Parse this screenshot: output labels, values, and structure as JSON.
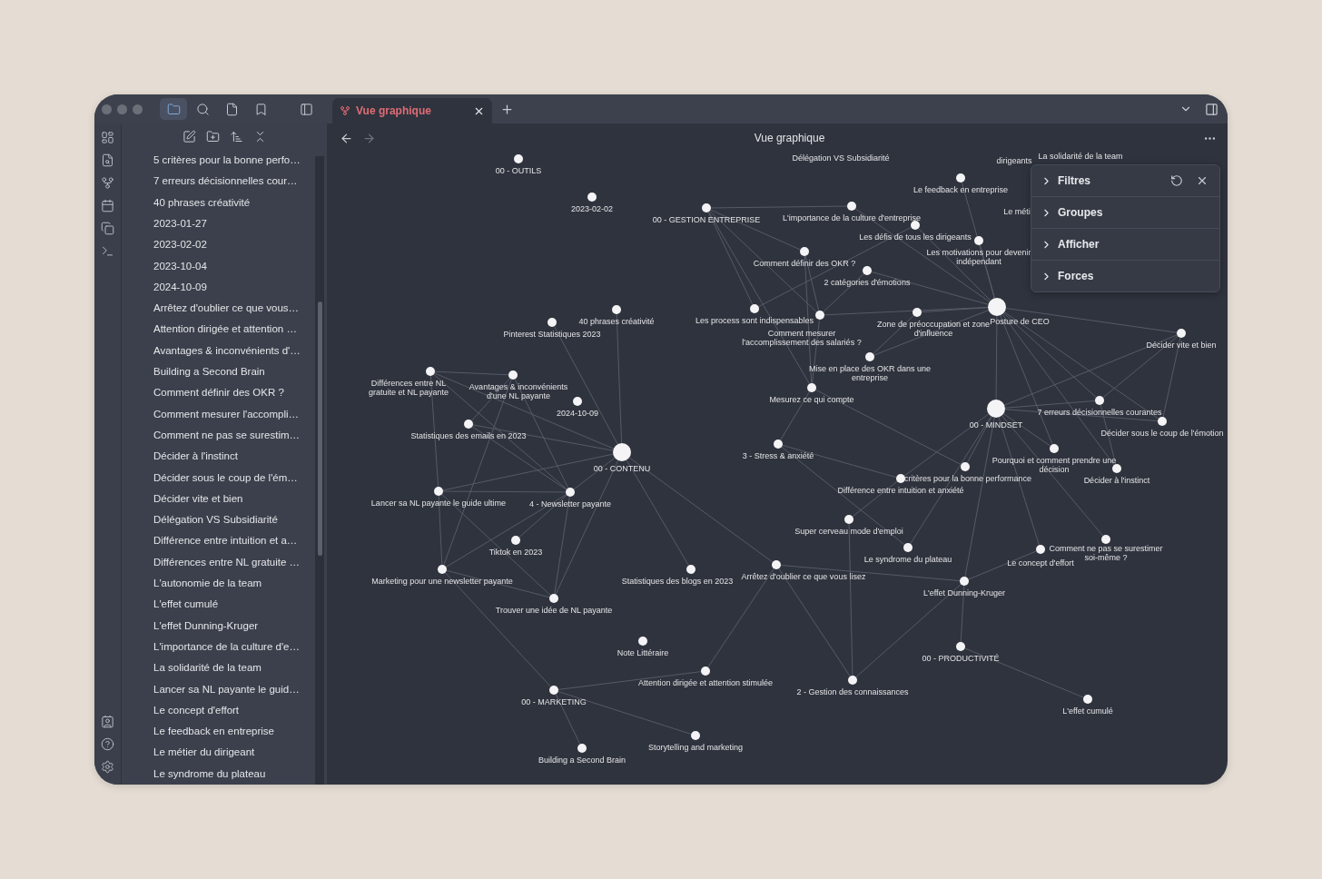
{
  "window": {
    "tabs": [
      {
        "label": "Vue graphique",
        "selected": true
      }
    ]
  },
  "file_list": [
    "5 critères pour la bonne perfo…",
    "7 erreurs décisionnelles cour…",
    "40 phrases créativité",
    "2023-01-27",
    "2023-02-02",
    "2023-10-04",
    "2024-10-09",
    "Arrêtez d'oublier ce que vous…",
    "Attention dirigée et attention …",
    "Avantages & inconvénients d'…",
    "Building a Second Brain",
    "Comment définir des OKR ?",
    "Comment mesurer l'accompli…",
    "Comment ne pas se surestim…",
    "Décider à l'instinct",
    "Décider sous le coup de l'ém…",
    "Décider vite et bien",
    "Délégation VS Subsidiarité",
    "Différence entre intuition et a…",
    "Différences entre NL gratuite …",
    "L'autonomie de la team",
    "L'effet cumulé",
    "L'effet Dunning-Kruger",
    "L'importance de la culture d'e…",
    "La solidarité de la team",
    "Lancer sa NL payante le guid…",
    "Le concept d'effort",
    "Le feedback en entreprise",
    "Le métier du dirigeant",
    "Le syndrome du plateau"
  ],
  "graph_view": {
    "title": "Vue graphique",
    "nodes": [
      {
        "label": "00 - OUTILS",
        "kind": "note"
      },
      {
        "label": "Le feedback en entreprise",
        "kind": "note"
      },
      {
        "label": "2023-02-02",
        "kind": "note"
      },
      {
        "label": "00 - GESTION ENTREPRISE",
        "kind": "note"
      },
      {
        "label": "L'importance de la culture d'entreprise",
        "kind": "note"
      },
      {
        "label": "Les défis de tous les dirigeants",
        "kind": "note"
      },
      {
        "label": "Comment définir des OKR ?",
        "kind": "note"
      },
      {
        "label": "Les motivations pour devenir indépendant",
        "kind": "note"
      },
      {
        "label": "2 catégories d'émotions",
        "kind": "note"
      },
      {
        "label": "Pinterest Statistiques 2023",
        "kind": "note"
      },
      {
        "label": "40 phrases créativité",
        "kind": "note"
      },
      {
        "label": "Les process sont indispensables",
        "kind": "note"
      },
      {
        "label": "Comment mesurer l'accomplissement des salariés ?",
        "kind": "note"
      },
      {
        "label": "Zone de préoccupation et zone d'influence",
        "kind": "note"
      },
      {
        "label": "Posture de CEO",
        "kind": "hub"
      },
      {
        "label": "Décider vite et bien",
        "kind": "note"
      },
      {
        "label": "Mise en place des OKR dans une entreprise",
        "kind": "note"
      },
      {
        "label": "Différences entre NL gratuite et NL payante",
        "kind": "note"
      },
      {
        "label": "Avantages & inconvénients d'une NL payante",
        "kind": "note"
      },
      {
        "label": "Mesurez ce qui compte",
        "kind": "note"
      },
      {
        "label": "2024-10-09",
        "kind": "note"
      },
      {
        "label": "00 - MINDSET",
        "kind": "hub"
      },
      {
        "label": "7 erreurs décisionnelles courantes",
        "kind": "note"
      },
      {
        "label": "Statistiques des emails en 2023",
        "kind": "note"
      },
      {
        "label": "Décider sous le coup de l'émotion",
        "kind": "note"
      },
      {
        "label": "00 - CONTENU",
        "kind": "hub"
      },
      {
        "label": "3 - Stress & anxiété",
        "kind": "note"
      },
      {
        "label": "critères pour la bonne performance",
        "kind": "note"
      },
      {
        "label": "Pourquoi et comment prendre une décision",
        "kind": "note"
      },
      {
        "label": "Décider à l'instinct",
        "kind": "note"
      },
      {
        "label": "Lancer sa NL payante le guide ultime",
        "kind": "note"
      },
      {
        "label": "4 - Newsletter payante",
        "kind": "note"
      },
      {
        "label": "Différence entre intuition et anxiété",
        "kind": "note"
      },
      {
        "label": "Super cerveau mode d'emploi",
        "kind": "note"
      },
      {
        "label": "Tiktok en 2023",
        "kind": "note"
      },
      {
        "label": "Le syndrome du plateau",
        "kind": "note"
      },
      {
        "label": "Le concept d'effort",
        "kind": "note"
      },
      {
        "label": "Comment ne pas se surestimer soi-même ?",
        "kind": "note"
      },
      {
        "label": "Marketing pour une newsletter payante",
        "kind": "note"
      },
      {
        "label": "Statistiques des blogs en 2023",
        "kind": "note"
      },
      {
        "label": "Arrêtez d'oublier ce que vous lisez",
        "kind": "note"
      },
      {
        "label": "L'effet Dunning-Kruger",
        "kind": "note"
      },
      {
        "label": "Trouver une idée de NL payante",
        "kind": "note"
      },
      {
        "label": "Note Littéraire",
        "kind": "note"
      },
      {
        "label": "00 - PRODUCTIVITÉ",
        "kind": "note"
      },
      {
        "label": "00 - MARKETING",
        "kind": "note"
      },
      {
        "label": "Attention dirigée et attention stimulée",
        "kind": "note"
      },
      {
        "label": "2 - Gestion des connaissances",
        "kind": "note"
      },
      {
        "label": "L'effet cumulé",
        "kind": "note"
      },
      {
        "label": "Building a Second Brain",
        "kind": "note"
      },
      {
        "label": "Storytelling and marketing",
        "kind": "note"
      }
    ],
    "cut_labels": [
      "Délégation VS Subsidiarité",
      "dirigeants",
      "La solidarité de la team",
      "Le méti"
    ]
  },
  "graph_controls": [
    {
      "label": "Filtres",
      "expanded": false
    },
    {
      "label": "Groupes",
      "expanded": false
    },
    {
      "label": "Afficher",
      "expanded": false
    },
    {
      "label": "Forces",
      "expanded": false
    }
  ]
}
